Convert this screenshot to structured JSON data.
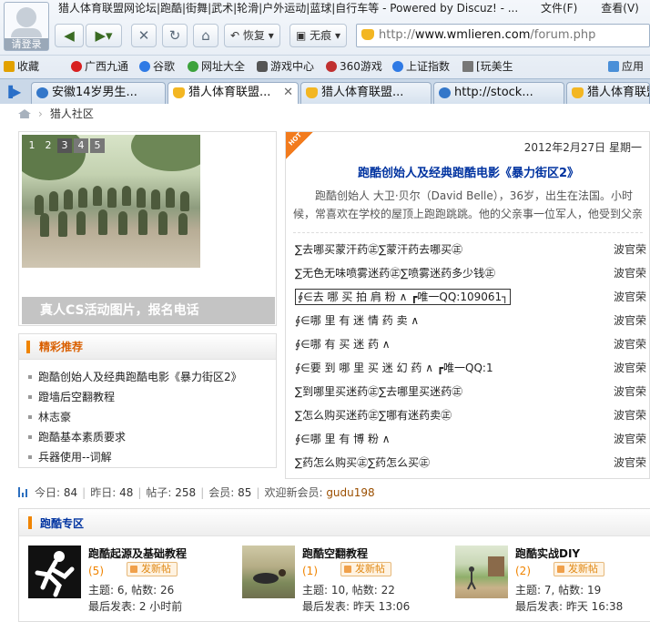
{
  "browser": {
    "window_title": "猎人体育联盟网论坛|跑酷|街舞|武术|轮滑|户外运动|蓝球|自行车等 - Powered by Discuz! - ...",
    "menu": [
      "文件(F)",
      "查看(V)"
    ],
    "avatar_label": "请登录",
    "restore_label": "恢复",
    "traceless_label": "无痕",
    "url_prefix": "http://",
    "url_domain": "www.wmlieren.com",
    "url_path": "/forum.php",
    "favorites": [
      {
        "label": "收藏",
        "icon": "star-icon",
        "color": "#e2a100"
      },
      {
        "label": "广西九通",
        "icon": "red-dot-icon",
        "color": "#d82020"
      },
      {
        "label": "谷歌",
        "icon": "google-icon",
        "color": "#2f7ae5"
      },
      {
        "label": "网址大全",
        "icon": "plus-icon",
        "color": "#3ca23c"
      },
      {
        "label": "游戏中心",
        "icon": "gamepad-icon",
        "color": "#555555"
      },
      {
        "label": "360游戏",
        "icon": "swirl-icon",
        "color": "#c03030"
      },
      {
        "label": "上证指数",
        "icon": "globe-icon",
        "color": "#2f7ae5"
      },
      {
        "label": "[玩美生",
        "icon": "page-icon",
        "color": "#777777"
      },
      {
        "label": "应用",
        "icon": "apps-icon",
        "color": "#4a8fd8"
      }
    ],
    "tabs": [
      {
        "label": "安徽14岁男生...",
        "color": "#3477c9",
        "active": false
      },
      {
        "label": "猎人体育联盟...",
        "color": "#f3b622",
        "active": true
      },
      {
        "label": "猎人体育联盟...",
        "color": "#f3b622",
        "active": false
      },
      {
        "label": "http://stock...",
        "color": "#3477c9",
        "active": false
      },
      {
        "label": "猎人体育联盟",
        "color": "#f3b622",
        "active": false
      }
    ]
  },
  "breadcrumb": {
    "current": "猎人社区"
  },
  "slider": {
    "numbers": [
      "1",
      "2",
      "3",
      "4",
      "5"
    ],
    "caption": "真人CS活动图片，报名电话"
  },
  "recommend": {
    "title": "精彩推荐",
    "items": [
      "跑酷创始人及经典跑酷电影《暴力街区2》",
      "蹬墙后空翻教程",
      "林志豪",
      "跑酷基本素质要求",
      "兵器使用--词解"
    ]
  },
  "headline": {
    "badge": "HOT",
    "date": "2012年2月27日 星期一",
    "title": "跑酷创始人及经典跑酷电影《暴力街区2》",
    "summary": "跑酷创始人 大卫·贝尔（David Belle），36岁，出生在法国。小时候，常喜欢在学校的屋顶上跑跑跳跳。他的父亲事一位军人，他受到父亲",
    "threads": [
      {
        "title": "∑去哪买蒙汗药㊣∑蒙汗药去哪买㊣",
        "author": "波官荣"
      },
      {
        "title": "∑无色无味喷雾迷药㊣∑喷雾迷药多少钱㊣",
        "author": "波官荣"
      },
      {
        "title": "∮∈去 哪 买 拍 肩 粉 ∧ ┏唯一QQ:109061┐",
        "author": "波官荣",
        "boxed": true
      },
      {
        "title": "∮∈哪 里 有 迷 情 药 卖 ∧",
        "author": "波官荣"
      },
      {
        "title": "∮∈哪 有 买 迷 药 ∧",
        "author": "波官荣"
      },
      {
        "title": "∮∈要 到 哪 里 买 迷 幻 药 ∧ ┏唯一QQ:1",
        "author": "波官荣"
      },
      {
        "title": "∑到哪里买迷药㊣∑去哪里买迷药㊣",
        "author": "波官荣"
      },
      {
        "title": "∑怎么购买迷药㊣∑哪有迷药卖㊣",
        "author": "波官荣"
      },
      {
        "title": "∮∈哪 里 有 博 粉 ∧",
        "author": "波官荣"
      },
      {
        "title": "∑药怎么购买㊣∑药怎么买㊣",
        "author": "波官荣"
      }
    ]
  },
  "stats": {
    "today_label": "今日:",
    "today": "84",
    "yesterday_label": "昨日:",
    "yesterday": "48",
    "posts_label": "帖子:",
    "posts": "258",
    "members_label": "会员:",
    "members": "85",
    "welcome_label": "欢迎新会员:",
    "newest_member": "gudu198"
  },
  "zone": {
    "title": "跑酷专区",
    "new_post_label": "发新帖",
    "forums": [
      {
        "name": "跑酷起源及基础教程",
        "today": "(5)",
        "meta": "主题: 6, 帖数: 26",
        "last": "最后发表: 2 小时前"
      },
      {
        "name": "跑酷空翻教程",
        "today": "(1)",
        "meta": "主题: 10, 帖数: 22",
        "last": "最后发表: 昨天 13:06"
      },
      {
        "name": "跑酷实战DIY",
        "today": "(2)",
        "meta": "主题: 7, 帖数: 19",
        "last": "最后发表: 昨天 16:38"
      }
    ]
  }
}
